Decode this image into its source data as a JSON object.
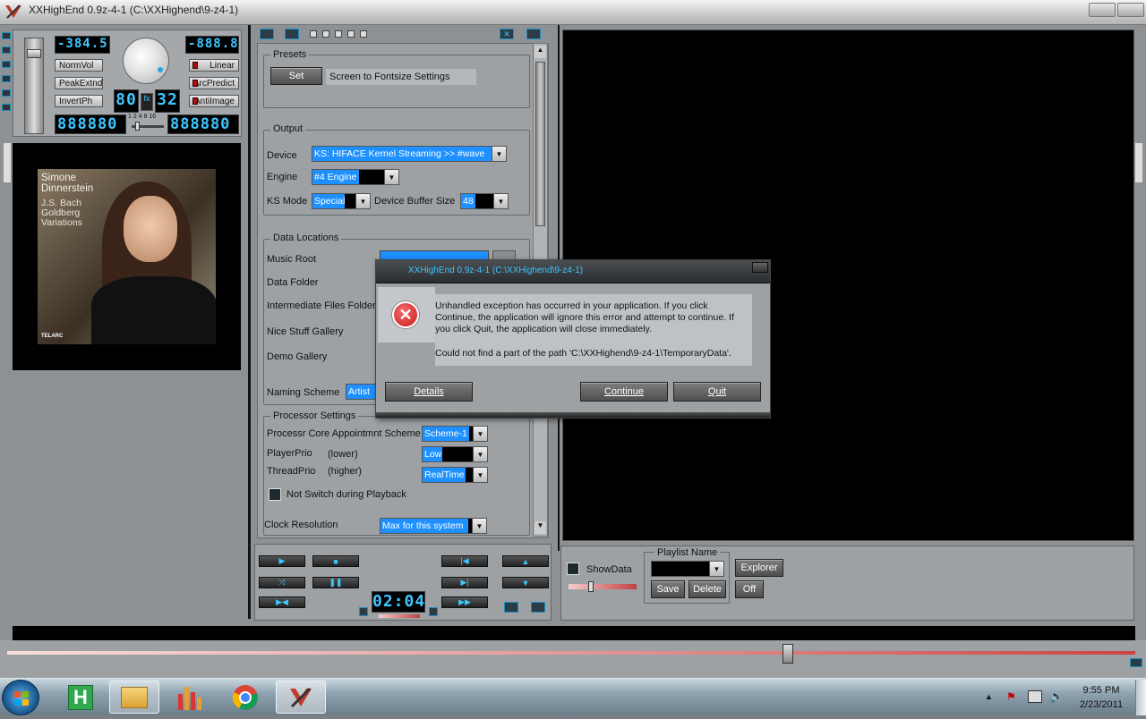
{
  "window": {
    "title": "XXHighEnd 0.9z-4-1 (C:\\XXHighend\\9-z4-1)"
  },
  "colors": {
    "accent": "#3fc6ff",
    "selection": "#1e90ff",
    "error": "#d62020",
    "background": "#8d9194"
  },
  "player": {
    "lcd_volume": "-384.5",
    "lcd_right": "-888.8",
    "lcd_left_big": "888880",
    "lcd_right_big": "888880",
    "lcd_small_a": "80",
    "lcd_small_b": "32",
    "fx_label": "fx",
    "scale_numbers": "1 2 4 8 16",
    "buttons": {
      "normvol": "NormVol",
      "peakextnd": "PeakExtnd",
      "invertph": "InvertPh",
      "linear": "Linear",
      "arcpredict": "ArcPredict",
      "antiimage": "AntiImage"
    }
  },
  "album": {
    "artist": "Simone Dinnerstein",
    "title": "J.S. Bach Goldberg Variations",
    "label": "TELARC"
  },
  "settings": {
    "presets": {
      "legend": "Presets",
      "set_button": "Set",
      "text": "Screen to Fontsize Settings"
    },
    "output": {
      "legend": "Output",
      "device_label": "Device",
      "device_value": "KS: HIFACE Kernel Streaming >> #wave",
      "engine_label": "Engine",
      "engine_value": "#4 Engine",
      "ksmode_label": "KS Mode",
      "ksmode_value": "Special",
      "buffer_label": "Device Buffer Size",
      "buffer_value": "48"
    },
    "data_locations": {
      "legend": "Data Locations",
      "music_root": "Music Root",
      "data_folder": "Data Folder",
      "intermediate": "Intermediate Files Folder",
      "nice_stuff": "Nice Stuff Gallery",
      "demo": "Demo Gallery",
      "naming_scheme": "Naming Scheme",
      "naming_value": "Artist"
    },
    "processor": {
      "legend": "Processor Settings",
      "core_label": "Processr Core Appointmnt Scheme",
      "core_value": "Scheme-1",
      "playerprio_label": "PlayerPrio",
      "playerprio_hint": "(lower)",
      "playerprio_value": "Low",
      "threadprio_label": "ThreadPrio",
      "threadprio_hint": "(higher)",
      "threadprio_value": "RealTime",
      "not_switch": "Not Switch during Playback",
      "clock_label": "Clock Resolution",
      "clock_value": "Max for this system"
    }
  },
  "transport": {
    "time": "02:04"
  },
  "playlist": {
    "showdata": "ShowData",
    "name_legend": "Playlist Name",
    "save": "Save",
    "delete": "Delete",
    "explorer": "Explorer",
    "off": "Off"
  },
  "dialog": {
    "title": "XXHighEnd 0.9z-4-1 (C:\\XXHighend\\9-z4-1)",
    "message": "Unhandled exception has occurred in your application. If you click Continue, the application will ignore this error and attempt to continue. If you click Quit, the application will close immediately.",
    "detail": "Could not find a part of the path 'C:\\XXHighend\\9-z4-1\\TemporaryData'.",
    "details_btn": "Details",
    "continue_btn": "Continue",
    "quit_btn": "Quit"
  },
  "taskbar": {
    "time": "9:55 PM",
    "date": "2/23/2011"
  }
}
